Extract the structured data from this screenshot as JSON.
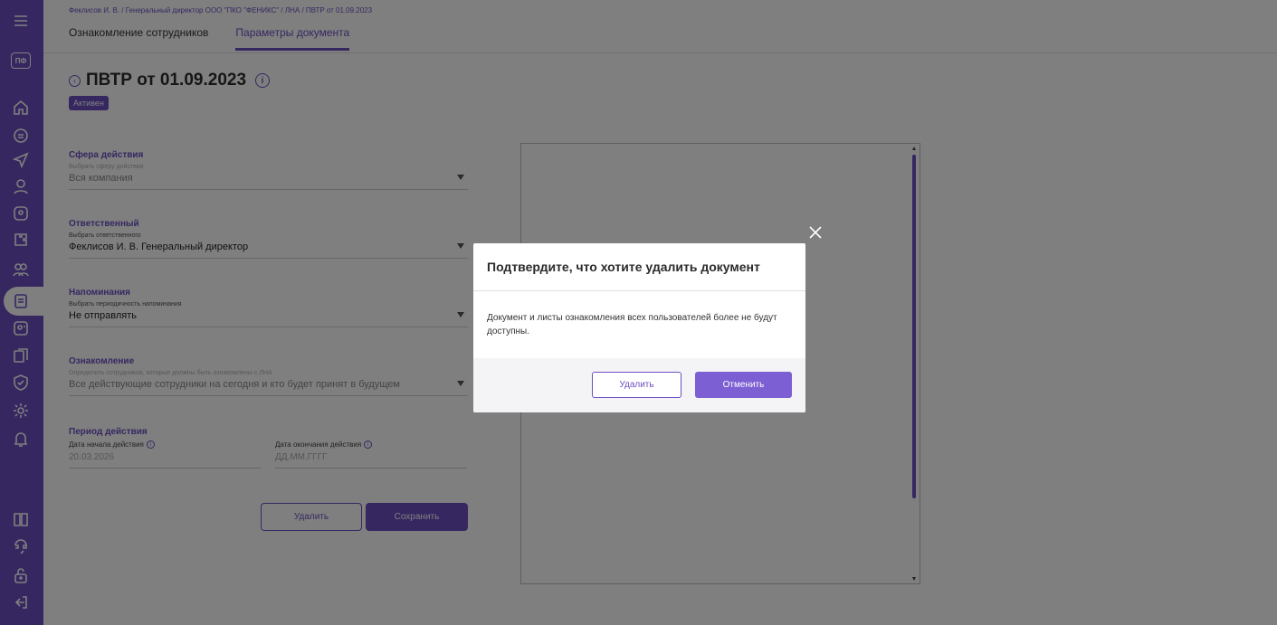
{
  "sidebar": {
    "logo": "ПФ",
    "icons": [
      "menu-icon",
      "home-icon",
      "document-icon",
      "send-icon",
      "user-icon",
      "badge-icon",
      "puzzle-icon",
      "users-icon",
      "clipboard-icon",
      "contact-icon",
      "files-icon",
      "shield-icon",
      "settings-icon",
      "bell-icon",
      "book-icon",
      "support-icon",
      "lock-icon",
      "logout-icon"
    ]
  },
  "header": {
    "breadcrumb": "Феклисов И. В. / Генеральный директор ООО \"ПКО \"ФЕНИКС\" / ЛНА / ПВТР от 01.09.2023",
    "tabs": [
      {
        "label": "Ознакомление сотрудников",
        "active": false
      },
      {
        "label": "Параметры документа",
        "active": true
      }
    ],
    "title": "ПВТР от 01.09.2023",
    "status": "Активен"
  },
  "form": {
    "scope": {
      "title": "Сфера действия",
      "hint": "Выбрать сферу действия",
      "value": "Вся компания"
    },
    "responsible": {
      "title": "Ответственный",
      "hint": "Выбрать ответственного",
      "value": "Феклисов И. В. Генеральный директор"
    },
    "reminders": {
      "title": "Напоминания",
      "hint": "Выбрать периодичность напоминания",
      "value": "Не отправлять"
    },
    "acquaintance": {
      "title": "Ознакомление",
      "hint": "Определить сотрудников, которые должны быть ознакомлены с ЛНА",
      "value": "Все действующие сотрудники на сегодня и кто будет принят в будущем"
    },
    "period": {
      "title": "Период действия",
      "start_label": "Дата начала действия",
      "start_value": "20.03.2026",
      "end_label": "Дата окончания действия",
      "end_placeholder": "ДД.ММ.ГГГГ"
    },
    "delete_label": "Удалить",
    "save_label": "Сохранить"
  },
  "modal": {
    "title": "Подтвердите, что хотите удалить документ",
    "body": "Документ и листы ознакомления всех пользователей более не будут доступны.",
    "delete_label": "Удалить",
    "cancel_label": "Отменить"
  },
  "colors": {
    "accent": "#6d4fc2",
    "overlay": "rgba(0,0,0,0.5)"
  }
}
